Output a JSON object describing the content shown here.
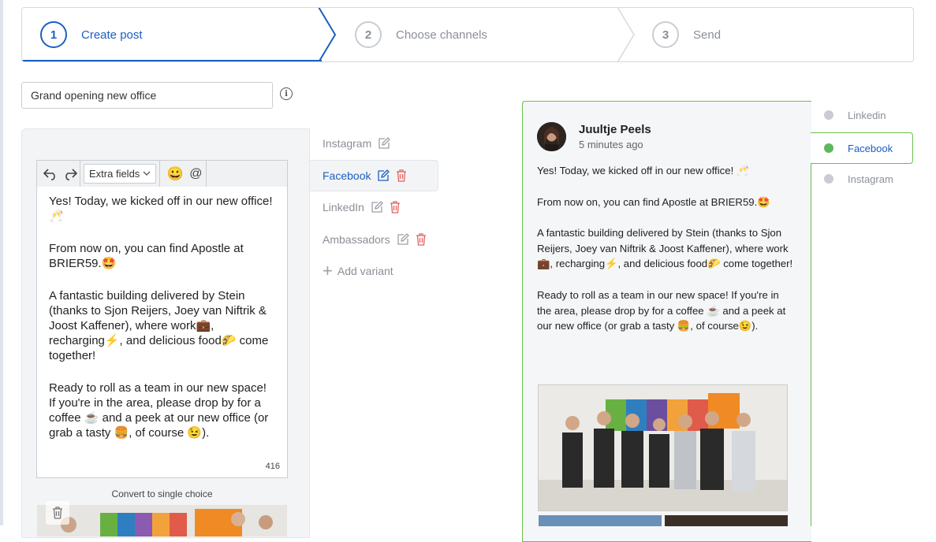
{
  "stepper": {
    "steps": [
      {
        "number": "1",
        "label": "Create post"
      },
      {
        "number": "2",
        "label": "Choose channels"
      },
      {
        "number": "3",
        "label": "Send"
      }
    ],
    "active_step": 1
  },
  "post": {
    "title_value": "Grand opening new office"
  },
  "editor": {
    "extra_fields_label": "Extra fields",
    "emoji_glyph": "😀",
    "mention_glyph": "@",
    "paragraphs": [
      "Yes! Today, we kicked off in our new office! 🥂",
      "From now on, you can find Apostle at BRIER59.🤩",
      "A fantastic building delivered by Stein (thanks to Sjon Reijers, Joey van Niftrik & Joost Kaffener), where work💼, recharging⚡, and delicious food🌮 come together!",
      "Ready to roll as a team in our new space! If you're in the area, please drop by for a coffee ☕ and a peek at our new office (or grab a tasty 🍔, of course 😉)."
    ],
    "char_count": "416",
    "convert_label": "Convert to single choice"
  },
  "variants": {
    "items": [
      {
        "label": "Instagram",
        "active": false,
        "deletable": false
      },
      {
        "label": "Facebook",
        "active": true,
        "deletable": true
      },
      {
        "label": "LinkedIn",
        "active": false,
        "deletable": true
      },
      {
        "label": "Ambassadors",
        "active": false,
        "deletable": true
      }
    ],
    "add_label": "Add variant"
  },
  "preview": {
    "author": "Juultje Peels",
    "time": "5 minutes ago",
    "paragraphs": [
      "Yes! Today, we kicked off in our new office! 🥂",
      "From now on, you can find Apostle at BRIER59.🤩",
      "A fantastic building delivered by Stein (thanks to Sjon Reijers, Joey van Niftrik & Joost Kaffener), where work💼, recharging⚡, and delicious food🌮 come together!",
      "Ready to roll as a team in our new space! If you're in the area, please drop by for a coffee ☕ and a peek at our new office (or grab a tasty 🍔, of course😉)."
    ]
  },
  "channels": {
    "items": [
      {
        "label": "Linkedin",
        "active": false
      },
      {
        "label": "Facebook",
        "active": true
      },
      {
        "label": "Instagram",
        "active": false
      }
    ]
  },
  "colors": {
    "accent_blue": "#1b5fc1",
    "preview_green": "#6abf4b",
    "delete_red": "#e06262"
  },
  "icons": [
    "undo-icon",
    "redo-icon",
    "chevron-down-icon",
    "emoji-icon",
    "at-icon",
    "info-icon",
    "edit-icon",
    "trash-icon",
    "plus-icon"
  ]
}
